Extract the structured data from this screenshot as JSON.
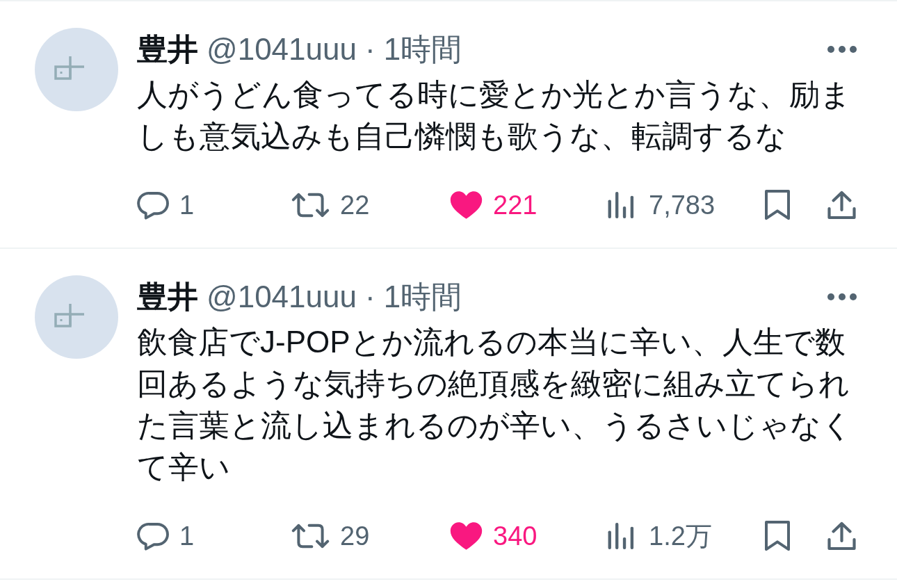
{
  "tweets": [
    {
      "author": {
        "name": "豊井",
        "handle": "@1041uuu",
        "separator": "·",
        "time": "1時間"
      },
      "text": "人がうどん食ってる時に愛とか光とか言うな、励ましも意気込みも自己憐憫も歌うな、転調するな",
      "actions": [
        {
          "kind": "reply",
          "count": "1"
        },
        {
          "kind": "retweet",
          "count": "22",
          "on": false
        },
        {
          "kind": "like",
          "count": "221",
          "on": true
        },
        {
          "kind": "views",
          "count": "7,783"
        },
        {
          "kind": "bookmark",
          "on": false
        },
        {
          "kind": "share"
        }
      ]
    },
    {
      "author": {
        "name": "豊井",
        "handle": "@1041uuu",
        "separator": "·",
        "time": "1時間"
      },
      "text": "飲食店でJ-POPとか流れるの本当に辛い、人生で数回あるような気持ちの絶頂感を緻密に組み立てられた言葉と流し込まれるのが辛い、うるさいじゃなくて辛い",
      "actions": [
        {
          "kind": "reply",
          "count": "1"
        },
        {
          "kind": "retweet",
          "count": "29",
          "on": false
        },
        {
          "kind": "like",
          "count": "340",
          "on": true
        },
        {
          "kind": "views",
          "count": "1.2万"
        },
        {
          "kind": "bookmark",
          "on": false
        },
        {
          "kind": "share"
        }
      ]
    }
  ]
}
